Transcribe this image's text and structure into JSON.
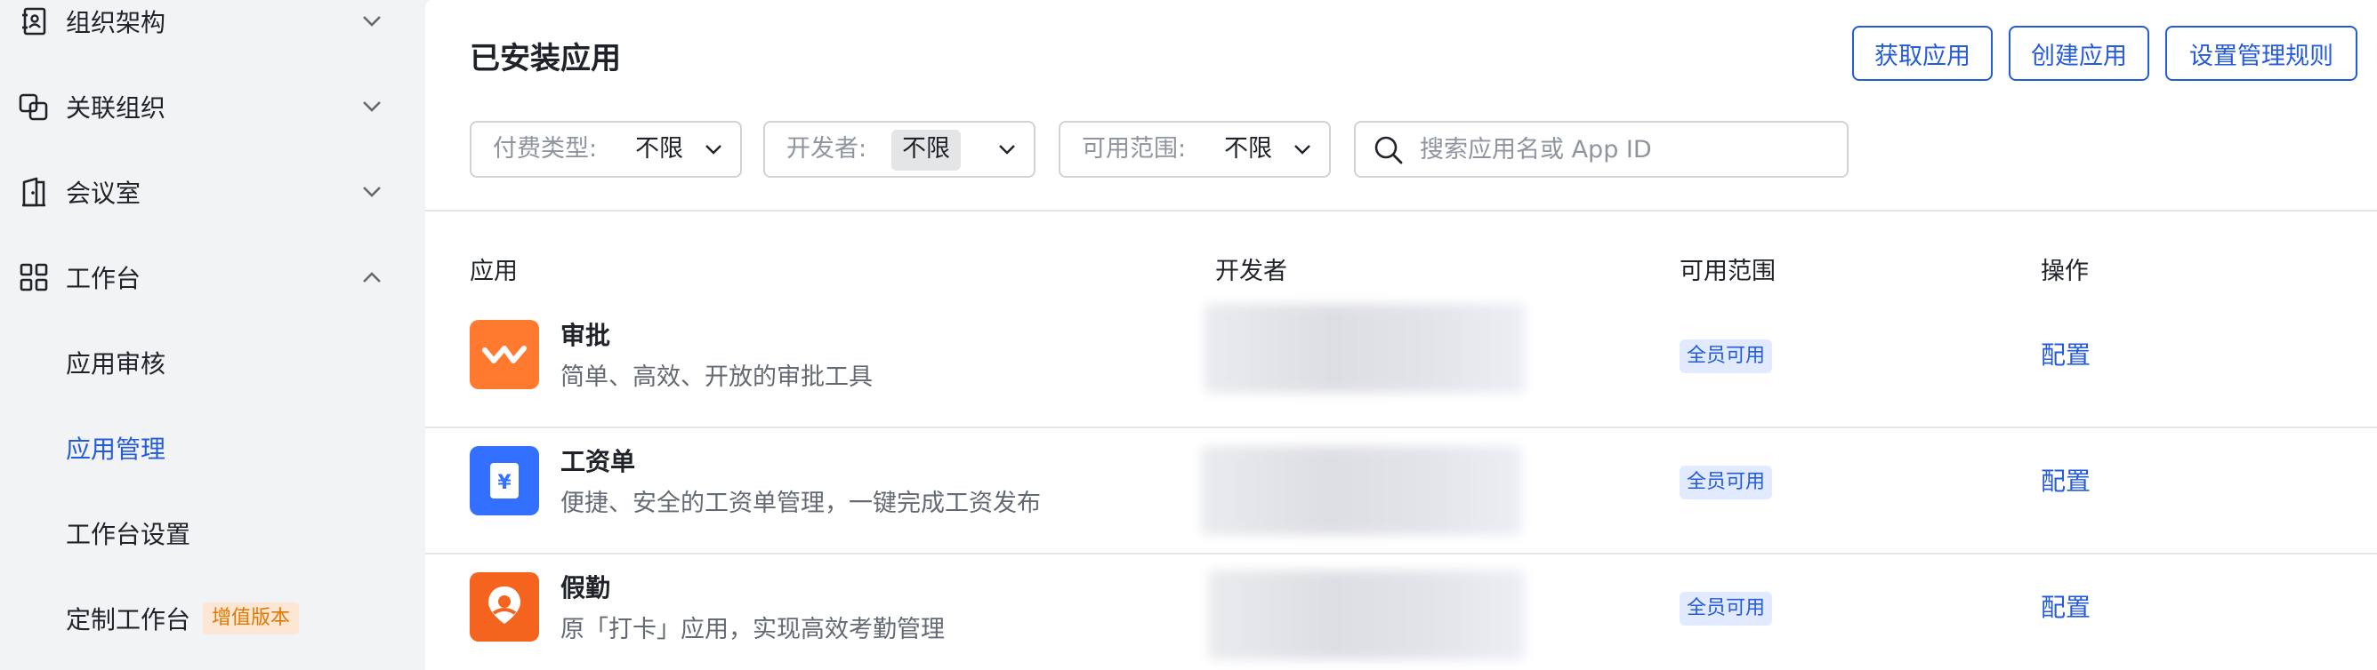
{
  "sidebar": {
    "items": [
      {
        "label": "组织架构",
        "icon": "org-contact-icon",
        "expanded": false
      },
      {
        "label": "关联组织",
        "icon": "link-org-icon",
        "expanded": false
      },
      {
        "label": "会议室",
        "icon": "door-icon",
        "expanded": false
      },
      {
        "label": "工作台",
        "icon": "grid-icon",
        "expanded": true
      }
    ],
    "sub_items": [
      {
        "label": "应用审核",
        "active": false
      },
      {
        "label": "应用管理",
        "active": true
      },
      {
        "label": "工作台设置",
        "active": false
      },
      {
        "label": "定制工作台",
        "active": false,
        "badge": "增值版本"
      }
    ]
  },
  "main": {
    "title": "已安装应用",
    "buttons": {
      "get_apps": "获取应用",
      "create_app": "创建应用",
      "manage_rules": "设置管理规则"
    },
    "filters": {
      "payment_type": {
        "label": "付费类型:",
        "value": "不限"
      },
      "developer": {
        "label": "开发者:",
        "value": "不限"
      },
      "scope": {
        "label": "可用范围:",
        "value": "不限"
      }
    },
    "search": {
      "placeholder": "搜索应用名或 App ID",
      "value": ""
    },
    "table": {
      "headers": {
        "app": "应用",
        "developer": "开发者",
        "scope": "可用范围",
        "action": "操作"
      },
      "rows": [
        {
          "name": "审批",
          "description": "简单、高效、开放的审批工具",
          "icon": "approval-icon",
          "icon_color": "#ff7a2e",
          "scope": "全员可用",
          "action": "配置"
        },
        {
          "name": "工资单",
          "description": "便捷、安全的工资单管理，一键完成工资发布",
          "icon": "payslip-icon",
          "icon_color": "#3370ff",
          "scope": "全员可用",
          "action": "配置"
        },
        {
          "name": "假勤",
          "description": "原「打卡」应用，实现高效考勤管理",
          "icon": "attendance-icon",
          "icon_color": "#f5641e",
          "scope": "全员可用",
          "action": "配置"
        }
      ]
    }
  },
  "colors": {
    "accent": "#245bdb",
    "sidebar_bg": "#f2f3f5",
    "badge_bg": "#fde7d4",
    "badge_text": "#de7802",
    "scope_tag_bg": "#e1eaff"
  }
}
